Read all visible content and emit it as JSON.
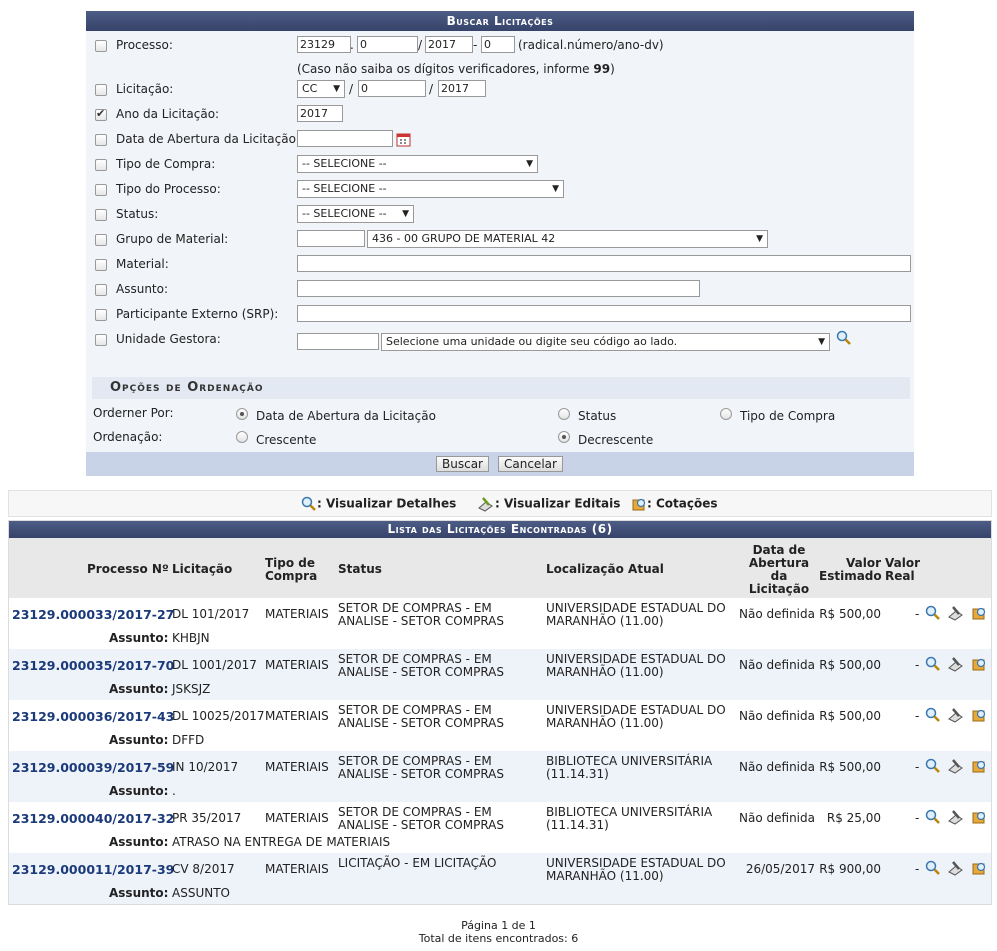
{
  "form": {
    "title": "Buscar Licitações",
    "processo": {
      "label": "Processo:",
      "radical": "23129",
      "numero": "0",
      "ano": "2017",
      "dv": "0",
      "sep1": ".",
      "sep2": "/",
      "sep3": "-",
      "hint": "(radical.número/ano-dv)",
      "note_pre": "(Caso não saiba os dígitos verificadores, informe ",
      "note_bold": "99",
      "note_post": ")"
    },
    "licitacao": {
      "label": "Licitação:",
      "modalidade": "CC",
      "numero": "0",
      "ano": "2017",
      "sep": "/"
    },
    "ano_licitacao": {
      "label": "Ano da Licitação:",
      "value": "2017"
    },
    "data_abertura": {
      "label": "Data de Abertura da Licitação:",
      "value": ""
    },
    "tipo_compra": {
      "label": "Tipo de Compra:",
      "selected": "-- SELECIONE --"
    },
    "tipo_processo": {
      "label": "Tipo do Processo:",
      "selected": "-- SELECIONE --"
    },
    "status": {
      "label": "Status:",
      "selected": "-- SELECIONE --"
    },
    "grupo_material": {
      "label": "Grupo de Material:",
      "code": "",
      "selected": "436 - 00 GRUPO DE MATERIAL 42"
    },
    "material": {
      "label": "Material:",
      "value": ""
    },
    "assunto": {
      "label": "Assunto:",
      "value": ""
    },
    "participante": {
      "label": "Participante Externo (SRP):",
      "value": ""
    },
    "unidade": {
      "label": "Unidade Gestora:",
      "code": "",
      "selected": "Selecione uma unidade ou digite seu código ao lado."
    },
    "ordenacao": {
      "title": "Opções de Ordenação",
      "ordenar_label": "Orderner Por:",
      "ordenar_options": [
        "Data de Abertura da Licitação",
        "Status",
        "Tipo de Compra"
      ],
      "ordem_label": "Ordenação:",
      "ordem_options": [
        "Crescente",
        "Decrescente"
      ]
    },
    "buttons": {
      "buscar": "Buscar",
      "cancelar": "Cancelar"
    }
  },
  "legend": {
    "detalhes": ": Visualizar Detalhes",
    "editais": ": Visualizar Editais",
    "cotacoes": ": Cotações"
  },
  "list": {
    "title": "Lista das Licitações Encontradas (6)",
    "headers": {
      "processo": "Processo Nº",
      "licitacao": "Licitação",
      "tipo": "Tipo de Compra",
      "status": "Status",
      "localizacao": "Localização Atual",
      "data": "Data de Abertura da Licitação",
      "estimado": "Valor Estimado",
      "real": "Valor Real"
    },
    "assunto_label": "Assunto:",
    "rows": [
      {
        "processo": "23129.000033/2017-27",
        "licitacao": "DL 101/2017",
        "tipo": "MATERIAIS",
        "status": "SETOR DE COMPRAS - EM ANALISE - SETOR COMPRAS",
        "localizacao": "UNIVERSIDADE ESTADUAL DO MARANHÃO (11.00)",
        "data": "Não definida",
        "estimado": "R$ 500,00",
        "real": "-",
        "assunto": "KHBJN"
      },
      {
        "processo": "23129.000035/2017-70",
        "licitacao": "DL 1001/2017",
        "tipo": "MATERIAIS",
        "status": "SETOR DE COMPRAS - EM ANALISE - SETOR COMPRAS",
        "localizacao": "UNIVERSIDADE ESTADUAL DO MARANHÃO (11.00)",
        "data": "Não definida",
        "estimado": "R$ 500,00",
        "real": "-",
        "assunto": "JSKSJZ"
      },
      {
        "processo": "23129.000036/2017-43",
        "licitacao": "DL 10025/2017",
        "tipo": "MATERIAIS",
        "status": "SETOR DE COMPRAS - EM ANALISE - SETOR COMPRAS",
        "localizacao": "UNIVERSIDADE ESTADUAL DO MARANHÃO (11.00)",
        "data": "Não definida",
        "estimado": "R$ 500,00",
        "real": "-",
        "assunto": "DFFD"
      },
      {
        "processo": "23129.000039/2017-59",
        "licitacao": "IN 10/2017",
        "tipo": "MATERIAIS",
        "status": "SETOR DE COMPRAS - EM ANALISE - SETOR COMPRAS",
        "localizacao": "BIBLIOTECA UNIVERSITÁRIA (11.14.31)",
        "data": "Não definida",
        "estimado": "R$ 500,00",
        "real": "-",
        "assunto": "."
      },
      {
        "processo": "23129.000040/2017-32",
        "licitacao": "PR 35/2017",
        "tipo": "MATERIAIS",
        "status": "SETOR DE COMPRAS - EM ANALISE - SETOR COMPRAS",
        "localizacao": "BIBLIOTECA UNIVERSITÁRIA (11.14.31)",
        "data": "Não definida",
        "estimado": "R$ 25,00",
        "real": "-",
        "assunto": "ATRASO NA ENTREGA DE MATERIAIS"
      },
      {
        "processo": "23129.000011/2017-39",
        "licitacao": "CV 8/2017",
        "tipo": "MATERIAIS",
        "status": "LICITAÇÃO - EM LICITAÇÃO",
        "localizacao": "UNIVERSIDADE ESTADUAL DO MARANHÃO (11.00)",
        "data": "26/05/2017",
        "estimado": "R$ 900,00",
        "real": "-",
        "assunto": "ASSUNTO"
      }
    ]
  },
  "pager": {
    "page": "Página 1 de 1",
    "total": "Total de itens encontrados: 6"
  },
  "colors": {
    "header": "#3f4d76",
    "link": "#1b3a7a",
    "row_alt": "#eef2f9",
    "form_bg": "#f1f4f9"
  }
}
